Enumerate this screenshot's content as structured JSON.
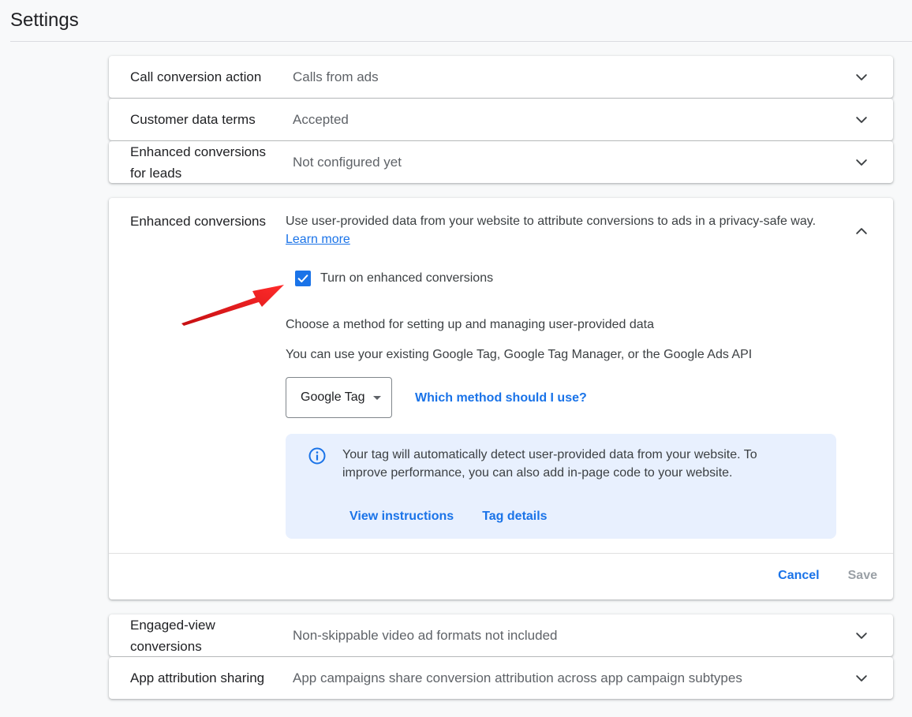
{
  "page": {
    "title": "Settings"
  },
  "rows": {
    "call_conversion": {
      "label": "Call conversion action",
      "value": "Calls from ads"
    },
    "customer_data": {
      "label": "Customer data terms",
      "value": "Accepted"
    },
    "enhanced_leads": {
      "label": "Enhanced conversions for leads",
      "value": "Not configured yet"
    },
    "engaged_view": {
      "label": "Engaged-view conversions",
      "value": "Non-skippable video ad formats not included"
    },
    "app_attribution": {
      "label": "App attribution sharing",
      "value": "App campaigns share conversion attribution across app campaign subtypes"
    }
  },
  "enhanced": {
    "label": "Enhanced conversions",
    "description": "Use user-provided data from your website to attribute conversions to ads in a privacy-safe way.",
    "learn_more": "Learn more",
    "checkbox_label": "Turn on enhanced conversions",
    "checkbox_checked": true,
    "method_heading": "Choose a method for setting up and managing user-provided data",
    "method_sub": "You can use your existing Google Tag, Google Tag Manager, or the Google Ads API",
    "dropdown_value": "Google Tag",
    "which_link": "Which method should I use?",
    "info_text": "Your tag will automatically detect user-provided data from your website. To improve performance, you can also add in-page code to your website.",
    "view_instructions": "View instructions",
    "tag_details": "Tag details",
    "cancel": "Cancel",
    "save": "Save"
  },
  "colors": {
    "accent": "#1a73e8",
    "info_bg": "#e8f0fe",
    "arrow": "#e8191d",
    "disabled": "#9aa0a6"
  },
  "icons": {
    "chevron_down": "chevron-down-icon",
    "chevron_up": "chevron-up-icon",
    "check": "check-icon",
    "info": "info-icon",
    "arrow": "annotation-arrow"
  }
}
